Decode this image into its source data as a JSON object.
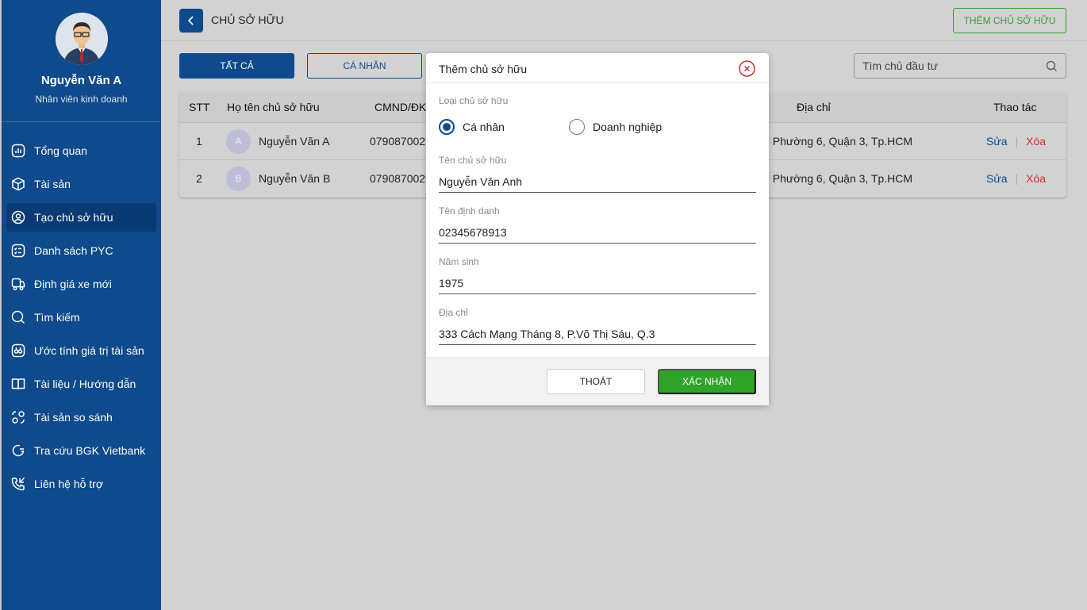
{
  "user": {
    "name": "Nguyễn Văn A",
    "role": "Nhân viên kinh doanh"
  },
  "sidebar": {
    "items": [
      {
        "label": "Tổng quan",
        "icon": "chart-icon"
      },
      {
        "label": "Tài sản",
        "icon": "box-icon"
      },
      {
        "label": "Tạo chủ sở hữu",
        "icon": "user-circle-icon",
        "active": true
      },
      {
        "label": "Danh sách PYC",
        "icon": "checklist-icon"
      },
      {
        "label": "Định giá xe mới",
        "icon": "truck-icon"
      },
      {
        "label": "Tìm kiếm",
        "icon": "search-icon"
      },
      {
        "label": "Ước tính giá trị tài sản",
        "icon": "calculator-icon"
      },
      {
        "label": "Tài liệu / Hướng dẫn",
        "icon": "book-icon"
      },
      {
        "label": "Tài sản so sánh",
        "icon": "compare-icon"
      },
      {
        "label": "Tra cứu BGK Vietbank",
        "icon": "refresh-search-icon"
      },
      {
        "label": "Liên hệ hỗ trợ",
        "icon": "phone-icon"
      }
    ]
  },
  "header": {
    "title": "CHỦ SỞ HỮU",
    "add_button": "THÊM CHỦ SỞ HỮU"
  },
  "filters": {
    "all": "TẤT CẢ",
    "individual": "CÁ NHÂN",
    "search_placeholder": "Tìm chủ đầu tư"
  },
  "table": {
    "headers": {
      "stt": "STT",
      "name": "Họ tên chủ sở hữu",
      "id": "CMND/ĐK",
      "address": "Địa chỉ",
      "actions": "Thao tác"
    },
    "rows": [
      {
        "stt": "1",
        "initial": "A",
        "name": "Nguyễn Văn A",
        "id": "079087002",
        "address": ", Phường 6, Quận 3, Tp.HCM",
        "edit": "Sửa",
        "delete": "Xóa"
      },
      {
        "stt": "2",
        "initial": "B",
        "name": "Nguyễn Văn B",
        "id": "079087002",
        "address": ", Phường 6, Quận 3, Tp.HCM",
        "edit": "Sửa",
        "delete": "Xóa"
      }
    ]
  },
  "modal": {
    "title": "Thêm chủ sở hữu",
    "owner_type_label": "Loại chủ sở hữu",
    "option_individual": "Cá nhân",
    "option_business": "Doanh nghiệp",
    "selected_option": "Cá nhân",
    "name_label": "Tên chủ sở hữu",
    "name_value": "Nguyễn Văn Anh",
    "identifier_label": "Tên định danh",
    "identifier_value": "02345678913",
    "birth_year_label": "Năm sinh",
    "birth_year_value": "1975",
    "address_label": "Địa chỉ",
    "address_value": "333 Cách Mạng Tháng 8, P.Võ Thị Sáu, Q.3",
    "exit_button": "THOÁT",
    "confirm_button": "XÁC NHẬN"
  },
  "colors": {
    "primary": "#0e4a8c",
    "success": "#2fa32a",
    "danger": "#d32f2f",
    "overlay": "#d2d2d2"
  }
}
